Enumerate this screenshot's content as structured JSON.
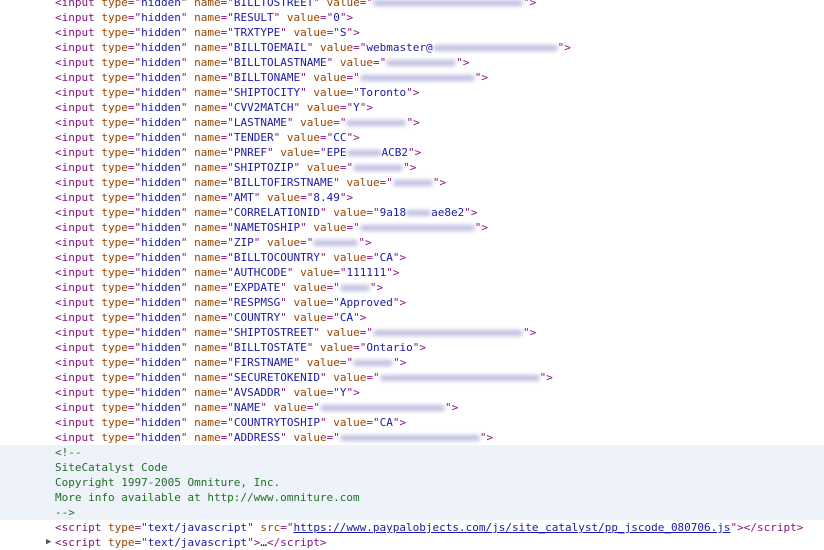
{
  "inputs": [
    {
      "type": "hidden",
      "name": "BILLTOSTREET",
      "value": "",
      "pre": "",
      "post": "",
      "blur": 150
    },
    {
      "type": "hidden",
      "name": "RESULT",
      "value": "0",
      "pre": "",
      "post": "",
      "blur": 0
    },
    {
      "type": "hidden",
      "name": "TRXTYPE",
      "value": "S",
      "pre": "",
      "post": "",
      "blur": 0
    },
    {
      "type": "hidden",
      "name": "BILLTOEMAIL",
      "value": "",
      "pre": "webmaster@",
      "post": "",
      "blur": 125
    },
    {
      "type": "hidden",
      "name": "BILLTOLASTNAME",
      "value": "",
      "pre": "",
      "post": "",
      "blur": 70
    },
    {
      "type": "hidden",
      "name": "BILLTONAME",
      "value": "",
      "pre": "",
      "post": "",
      "blur": 115
    },
    {
      "type": "hidden",
      "name": "SHIPTOCITY",
      "value": "Toronto",
      "pre": "",
      "post": "",
      "blur": 0
    },
    {
      "type": "hidden",
      "name": "CVV2MATCH",
      "value": "Y",
      "pre": "",
      "post": "",
      "blur": 0
    },
    {
      "type": "hidden",
      "name": "LASTNAME",
      "value": "",
      "pre": "",
      "post": "",
      "blur": 60
    },
    {
      "type": "hidden",
      "name": "TENDER",
      "value": "CC",
      "pre": "",
      "post": "",
      "blur": 0
    },
    {
      "type": "hidden",
      "name": "PNREF",
      "value": "",
      "pre": "EPE",
      "post": "ACB2",
      "blur": 35
    },
    {
      "type": "hidden",
      "name": "SHIPTOZIP",
      "value": "",
      "pre": "",
      "post": "",
      "blur": 50
    },
    {
      "type": "hidden",
      "name": "BILLTOFIRSTNAME",
      "value": "",
      "pre": "",
      "post": "",
      "blur": 40
    },
    {
      "type": "hidden",
      "name": "AMT",
      "value": "8.49",
      "pre": "",
      "post": "",
      "blur": 0
    },
    {
      "type": "hidden",
      "name": "CORRELATIONID",
      "value": "",
      "pre": "9a18",
      "post": "ae8e2",
      "blur": 25
    },
    {
      "type": "hidden",
      "name": "NAMETOSHIP",
      "value": "",
      "pre": "",
      "post": "",
      "blur": 115
    },
    {
      "type": "hidden",
      "name": "ZIP",
      "value": "",
      "pre": "",
      "post": "",
      "blur": 45
    },
    {
      "type": "hidden",
      "name": "BILLTOCOUNTRY",
      "value": "CA",
      "pre": "",
      "post": "",
      "blur": 0
    },
    {
      "type": "hidden",
      "name": "AUTHCODE",
      "value": "111111",
      "pre": "",
      "post": "",
      "blur": 0
    },
    {
      "type": "hidden",
      "name": "EXPDATE",
      "value": "",
      "pre": "",
      "post": "",
      "blur": 30
    },
    {
      "type": "hidden",
      "name": "RESPMSG",
      "value": "Approved",
      "pre": "",
      "post": "",
      "blur": 0
    },
    {
      "type": "hidden",
      "name": "COUNTRY",
      "value": "CA",
      "pre": "",
      "post": "",
      "blur": 0
    },
    {
      "type": "hidden",
      "name": "SHIPTOSTREET",
      "value": "",
      "pre": "",
      "post": "",
      "blur": 150
    },
    {
      "type": "hidden",
      "name": "BILLTOSTATE",
      "value": "Ontario",
      "pre": "",
      "post": "",
      "blur": 0
    },
    {
      "type": "hidden",
      "name": "FIRSTNAME",
      "value": "",
      "pre": "",
      "post": "",
      "blur": 40
    },
    {
      "type": "hidden",
      "name": "SECURETOKENID",
      "value": "",
      "pre": "",
      "post": "",
      "blur": 160
    },
    {
      "type": "hidden",
      "name": "AVSADDR",
      "value": "Y",
      "pre": "",
      "post": "",
      "blur": 0
    },
    {
      "type": "hidden",
      "name": "NAME",
      "value": "",
      "pre": "",
      "post": "",
      "blur": 125
    },
    {
      "type": "hidden",
      "name": "COUNTRYTOSHIP",
      "value": "CA",
      "pre": "",
      "post": "",
      "blur": 0
    },
    {
      "type": "hidden",
      "name": "ADDRESS",
      "value": "",
      "pre": "",
      "post": "",
      "blur": 140
    }
  ],
  "comment": {
    "open": "<!--",
    "lines": [
      "SiteCatalyst Code",
      "Copyright 1997-2005 Omniture, Inc.",
      "More info available at http://www.omniture.com"
    ],
    "close": "-->"
  },
  "script1": {
    "type": "text/javascript",
    "src": "https://www.paypalobjects.com/js/site_catalyst/pp_jscode_080706.js"
  },
  "script2": {
    "type": "text/javascript",
    "collapsed": "…"
  },
  "colors": {
    "tag": "#881280",
    "attr_name": "#994500",
    "attr_value": "#1a1aa6",
    "comment": "#236e25",
    "comment_bg": "#eef3fa"
  }
}
